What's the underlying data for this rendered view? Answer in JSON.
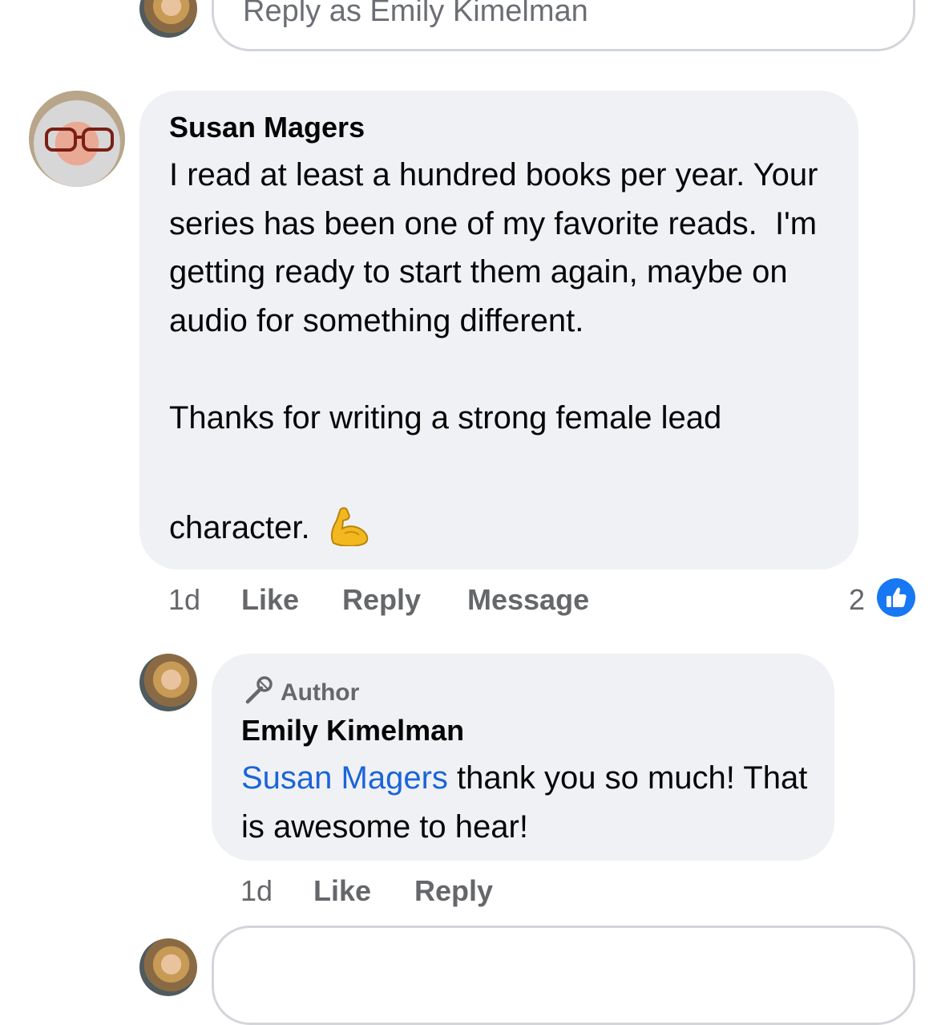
{
  "top_reply": {
    "placeholder": "Reply as Emily Kimelman"
  },
  "comment": {
    "author": "Susan Magers",
    "text": "I read at least a hundred books per year. Your series has been one of my favorite reads.  I'm getting ready to start them again, maybe on audio for something different.\n\nThanks for writing a strong female lead",
    "last_line": "character.",
    "emoji": "flexed-biceps-icon",
    "time": "1d",
    "actions": {
      "like": "Like",
      "reply": "Reply",
      "message": "Message"
    },
    "reaction_count": "2"
  },
  "reply": {
    "badge": "Author",
    "author": "Emily Kimelman",
    "mention": "Susan Magers",
    "text": " thank you so much! That is awesome to hear!",
    "time": "1d",
    "actions": {
      "like": "Like",
      "reply": "Reply"
    }
  },
  "colors": {
    "bubble": "#f0f1f5",
    "link": "#1a65d8",
    "muted": "#65676b",
    "like_blue": "#1877f2"
  }
}
